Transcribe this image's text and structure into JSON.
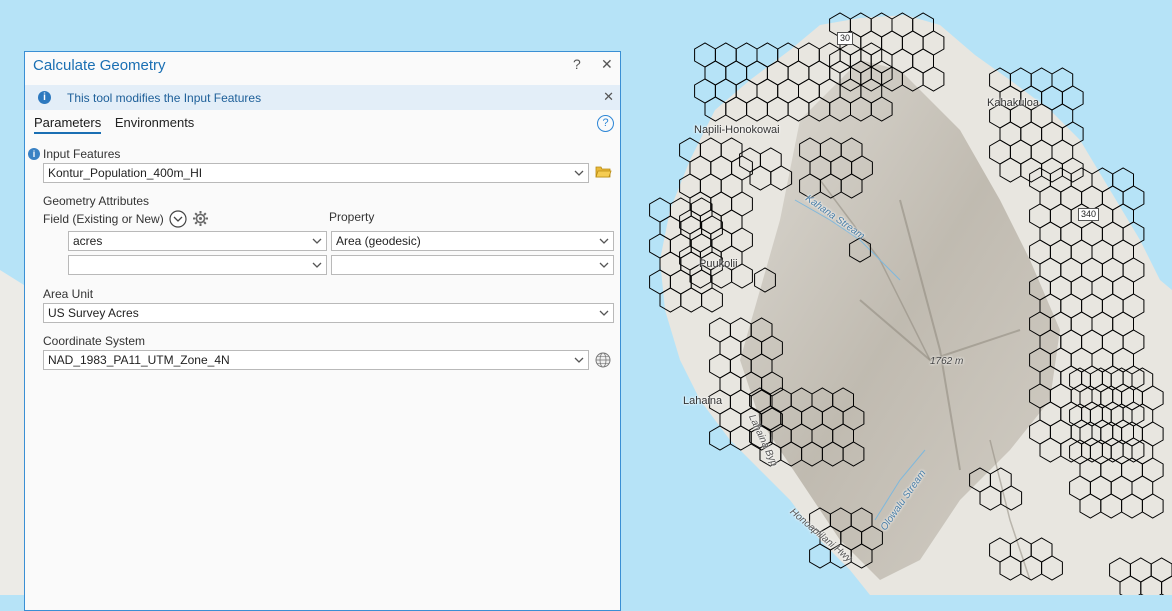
{
  "map": {
    "labels": {
      "napili": "Napili-Honokowai",
      "kahakuloa": "Kahakuloa",
      "puukolii": "Puukolii",
      "lahaina": "Lahaina",
      "kahana_stream": "Kahana Stream",
      "lahaina_byp": "Lahaina Byp",
      "honoapiilani": "Honoapiilani Hwy",
      "olowalu": "Olowalu Stream",
      "elevation": "1762 m",
      "route_30": "30",
      "route_340": "340"
    }
  },
  "dialog": {
    "title": "Calculate Geometry",
    "help_glyph": "?",
    "close_glyph": "✕",
    "info_text": "This tool modifies the Input Features",
    "tabs": [
      "Parameters",
      "Environments"
    ],
    "input_features_label": "Input Features",
    "input_features_value": "Kontur_Population_400m_HI",
    "geometry_attributes_label": "Geometry Attributes",
    "field_header": "Field (Existing or New)",
    "property_header": "Property",
    "rows": [
      {
        "field": "acres",
        "property": "Area (geodesic)"
      },
      {
        "field": "",
        "property": ""
      }
    ],
    "area_unit_label": "Area Unit",
    "area_unit_value": "US Survey Acres",
    "coord_system_label": "Coordinate System",
    "coord_system_value": "NAD_1983_PA11_UTM_Zone_4N"
  },
  "colors": {
    "accent": "#1a6fb3",
    "ocean": "#b6e3f7",
    "land": "#e9e7e1",
    "hex_stroke": "#000000"
  }
}
